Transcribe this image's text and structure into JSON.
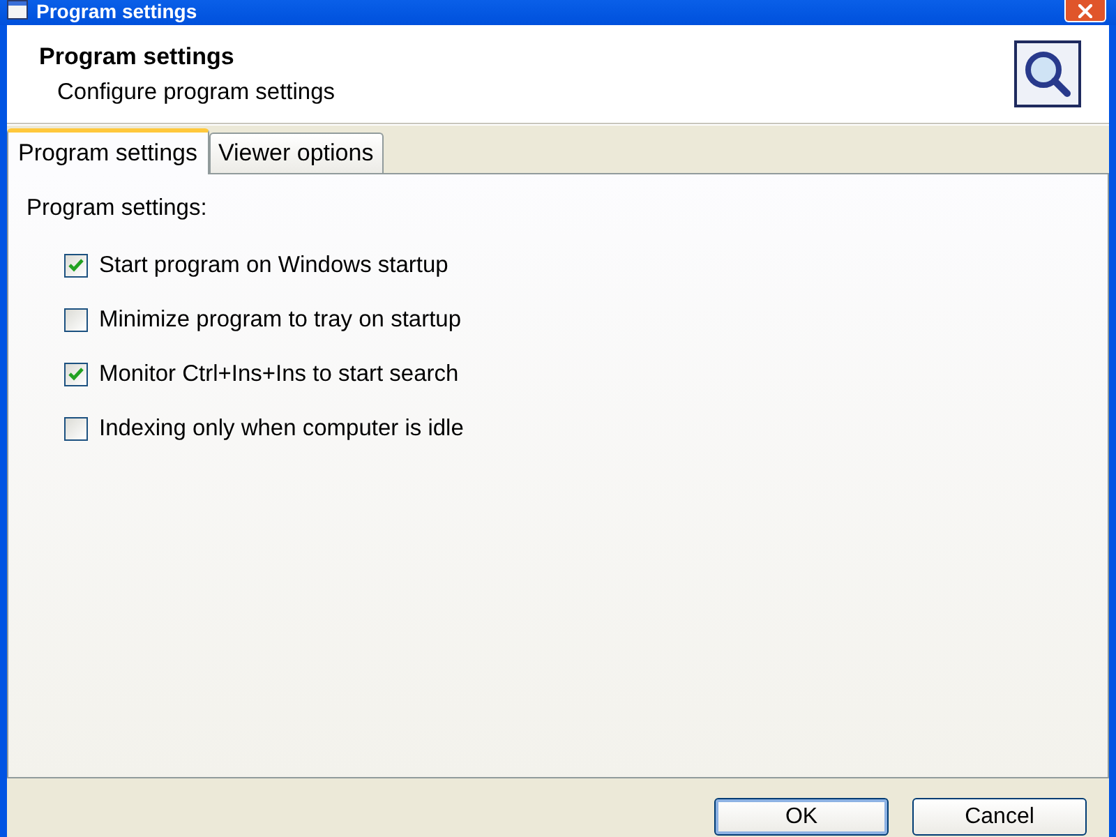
{
  "window": {
    "title": "Program settings"
  },
  "header": {
    "title": "Program settings",
    "subtitle": "Configure program settings"
  },
  "tabs": [
    {
      "label": "Program settings",
      "selected": true
    },
    {
      "label": "Viewer options",
      "selected": false
    }
  ],
  "panel": {
    "heading": "Program settings:",
    "options": [
      {
        "label": "Start program on Windows startup",
        "checked": true
      },
      {
        "label": "Minimize program to tray on startup",
        "checked": false
      },
      {
        "label": "Monitor Ctrl+Ins+Ins to start search",
        "checked": true
      },
      {
        "label": "Indexing only when computer is idle",
        "checked": false
      }
    ]
  },
  "buttons": [
    {
      "label": "OK",
      "default": true
    },
    {
      "label": "Cancel",
      "default": false
    }
  ]
}
